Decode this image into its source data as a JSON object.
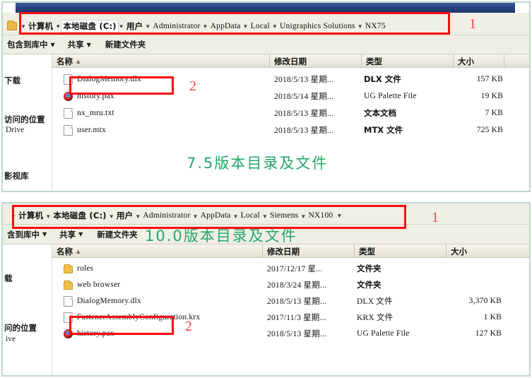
{
  "colors": {
    "annotation_red": "#fb0d0d",
    "annotation_number": "#f0424a",
    "label_green": "#25a86a",
    "window_border": "#bfd8c8",
    "titlebar_blue": "#27417a",
    "chrome_beige": "#f0efe6"
  },
  "window1": {
    "name": "nx75-explorer-window",
    "address_bar": {
      "folder_icon": "folder-icon",
      "crumbs": [
        {
          "label": "计算机",
          "lang": "cn"
        },
        {
          "label": "本地磁盘 (C:)",
          "lang": "cn",
          "highlight": true
        },
        {
          "label": "用户",
          "lang": "cn"
        },
        {
          "label": "Administrator",
          "lang": "en"
        },
        {
          "label": "AppData",
          "lang": "en"
        },
        {
          "label": "Local",
          "lang": "en"
        },
        {
          "label": "Unigraphics Solutions",
          "lang": "en"
        },
        {
          "label": "NX75",
          "lang": "en"
        }
      ]
    },
    "toolbar": {
      "items": [
        {
          "label": "包含到库中",
          "caret": true
        },
        {
          "label": "共享",
          "caret": true
        },
        {
          "label": "新建文件夹",
          "caret": false
        }
      ]
    },
    "nav_pane": {
      "entries": [
        "下载",
        "访问的位置",
        "Drive",
        "影视库"
      ]
    },
    "columns": [
      {
        "label": "名称",
        "sorted": true,
        "sort_arrow": "▲"
      },
      {
        "label": "修改日期",
        "sorted": false
      },
      {
        "label": "类型",
        "sorted": false
      },
      {
        "label": "大小",
        "sorted": false
      }
    ],
    "rows": [
      {
        "icon": "file-icon",
        "name": "DialogMemory.dlx",
        "date": "2018/5/13 星期...",
        "type": "DLX 文件",
        "size": "157 KB"
      },
      {
        "icon": "pax-file-icon",
        "name": "history.pax",
        "date": "2018/5/14 星期...",
        "type": "UG Palette File",
        "size": "19 KB"
      },
      {
        "icon": "file-icon",
        "name": "nx_mru.txt",
        "date": "2018/5/13 星期...",
        "type": "文本文档",
        "size": "7 KB"
      },
      {
        "icon": "file-icon",
        "name": "user.mtx",
        "date": "2018/5/13 星期...",
        "type": "MTX 文件",
        "size": "725 KB"
      }
    ],
    "annotations": {
      "address_marker": "1",
      "file_marker": "2",
      "caption": "7.5版本目录及文件"
    }
  },
  "window2": {
    "name": "nx100-explorer-window",
    "address_bar": {
      "crumbs": [
        {
          "label": "计算机",
          "lang": "cn"
        },
        {
          "label": "本地磁盘 (C:)",
          "lang": "cn"
        },
        {
          "label": "用户",
          "lang": "cn"
        },
        {
          "label": "Administrator",
          "lang": "en"
        },
        {
          "label": "AppData",
          "lang": "en"
        },
        {
          "label": "Local",
          "lang": "en"
        },
        {
          "label": "Siemens",
          "lang": "en"
        },
        {
          "label": "NX100",
          "lang": "en"
        }
      ]
    },
    "toolbar": {
      "items": [
        {
          "label": "含到库中",
          "caret": true
        },
        {
          "label": "共享",
          "caret": true
        },
        {
          "label": "新建文件夹",
          "caret": false
        }
      ]
    },
    "nav_pane": {
      "entries": [
        "载",
        "问的位置",
        "ive"
      ]
    },
    "columns": [
      {
        "label": "名称",
        "sorted": true,
        "sort_arrow": "▲"
      },
      {
        "label": "修改日期",
        "sorted": false
      },
      {
        "label": "类型",
        "sorted": false
      },
      {
        "label": "大小",
        "sorted": false
      }
    ],
    "rows": [
      {
        "icon": "folder-icon",
        "name": "roles",
        "date": "2017/12/17 星...",
        "type": "文件夹",
        "size": ""
      },
      {
        "icon": "folder-icon",
        "name": "web browser",
        "date": "2018/3/24 星期...",
        "type": "文件夹",
        "size": ""
      },
      {
        "icon": "file-icon",
        "name": "DialogMemory.dlx",
        "date": "2018/5/13 星期...",
        "type": "DLX 文件",
        "size": "3,370 KB"
      },
      {
        "icon": "file-icon",
        "name": "FastenerAssemblyConfiguration.krx",
        "date": "2017/11/3 星期...",
        "type": "KRX 文件",
        "size": "1 KB"
      },
      {
        "icon": "pax-file-icon",
        "name": "history.pax",
        "date": "2018/5/13 星期...",
        "type": "UG Palette File",
        "size": "127 KB"
      }
    ],
    "annotations": {
      "address_marker": "1",
      "file_marker": "2",
      "caption": "10.0版本目录及文件"
    }
  }
}
